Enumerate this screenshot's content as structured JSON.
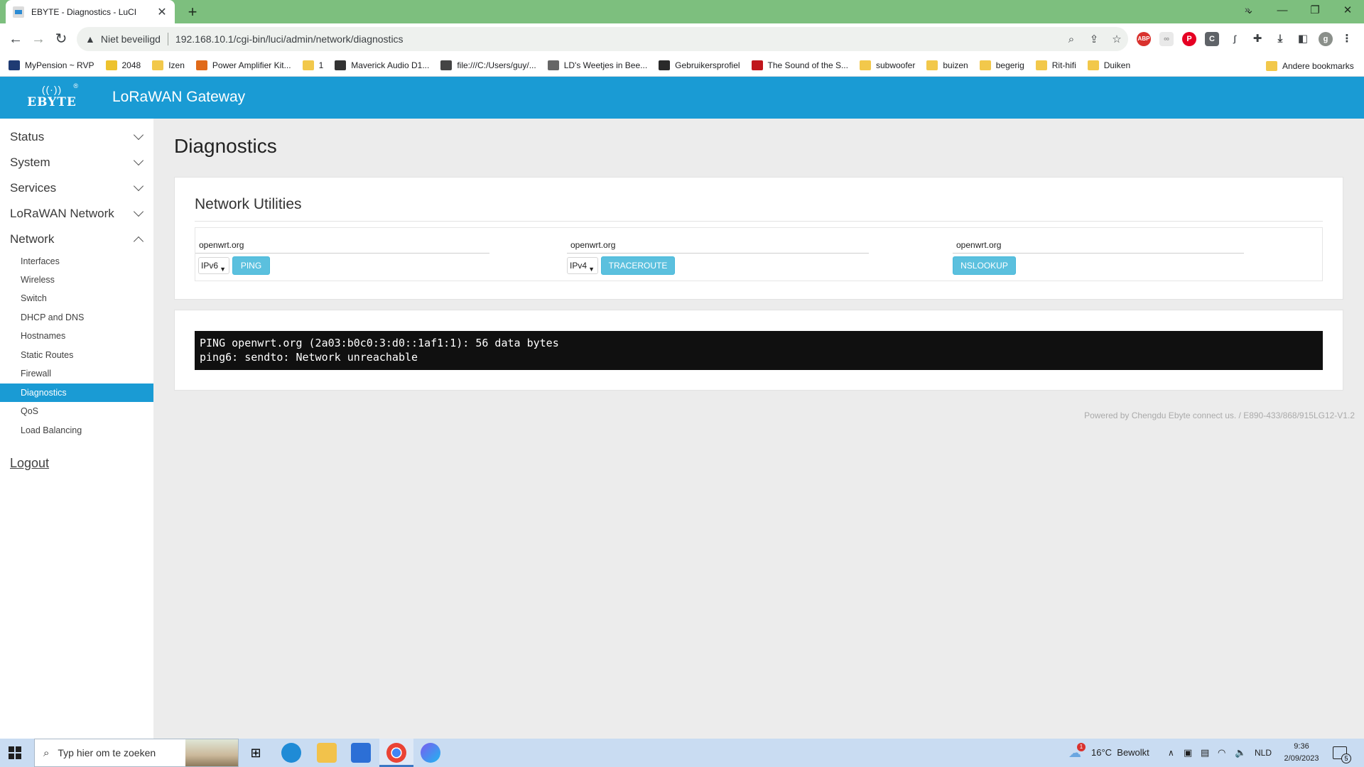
{
  "browser": {
    "tab_title": "EBYTE - Diagnostics - LuCI",
    "tab_close": "✕",
    "new_tab": "+",
    "security_label": "Niet beveiligd",
    "url": "192.168.10.1/cgi-bin/luci/admin/network/diagnostics",
    "bookmarks": [
      {
        "label": "MyPension ~ RVP",
        "icon_color": "#1f3b73"
      },
      {
        "label": "2048",
        "icon_color": "#edc22e"
      },
      {
        "label": "Izen",
        "icon_color": "#f2c84b"
      },
      {
        "label": "Power Amplifier Kit...",
        "icon_color": "#e06a1a"
      },
      {
        "label": "1",
        "icon_color": "#f2c84b"
      },
      {
        "label": "Maverick Audio D1...",
        "icon_color": "#333333"
      },
      {
        "label": "file:///C:/Users/guy/...",
        "icon_color": "#444444"
      },
      {
        "label": "LD's Weetjes in Bee...",
        "icon_color": "#666666"
      },
      {
        "label": "Gebruikersprofiel",
        "icon_color": "#2a2a2a"
      },
      {
        "label": "The Sound of the S...",
        "icon_color": "#c0161c"
      },
      {
        "label": "subwoofer",
        "icon_color": "#f2c84b"
      },
      {
        "label": "buizen",
        "icon_color": "#f2c84b"
      },
      {
        "label": "begerig",
        "icon_color": "#f2c84b"
      },
      {
        "label": "Rit-hifi",
        "icon_color": "#f2c84b"
      },
      {
        "label": "Duiken",
        "icon_color": "#f2c84b"
      }
    ],
    "bookmarks_more": "»",
    "other_bookmarks": "Andere bookmarks",
    "profile_initial": "g"
  },
  "header": {
    "brand": "EBYTE",
    "registered": "®",
    "app_title": "LoRaWAN Gateway"
  },
  "sidebar": {
    "menus": [
      {
        "label": "Status",
        "expanded": false
      },
      {
        "label": "System",
        "expanded": false
      },
      {
        "label": "Services",
        "expanded": false
      },
      {
        "label": "LoRaWAN Network",
        "expanded": false
      },
      {
        "label": "Network",
        "expanded": true
      }
    ],
    "network_items": [
      {
        "label": "Interfaces"
      },
      {
        "label": "Wireless"
      },
      {
        "label": "Switch"
      },
      {
        "label": "DHCP and DNS"
      },
      {
        "label": "Hostnames"
      },
      {
        "label": "Static Routes"
      },
      {
        "label": "Firewall"
      },
      {
        "label": "Diagnostics",
        "active": true
      },
      {
        "label": "QoS"
      },
      {
        "label": "Load Balancing"
      }
    ],
    "logout": "Logout"
  },
  "main": {
    "title": "Diagnostics",
    "section_title": "Network Utilities",
    "ping": {
      "host": "openwrt.org",
      "protocol": "IPv6",
      "button": "PING"
    },
    "traceroute": {
      "host": "openwrt.org",
      "protocol": "IPv4",
      "button": "TRACEROUTE"
    },
    "nslookup": {
      "host": "openwrt.org",
      "button": "NSLOOKUP"
    },
    "output": "PING openwrt.org (2a03:b0c0:3:d0::1af1:1): 56 data bytes\nping6: sendto: Network unreachable",
    "footer": "Powered by Chengdu Ebyte connect us. / E890-433/868/915LG12-V1.2"
  },
  "taskbar": {
    "search_placeholder": "Typ hier om te zoeken",
    "weather": "16°C  Bewolkt",
    "language": "NLD",
    "time": "9:36",
    "date": "2/09/2023",
    "notifications": "5",
    "weather_alert": "1"
  },
  "colors": {
    "accent": "#1a9bd4",
    "button": "#5bc0de",
    "tabbar": "#7dbf7e"
  }
}
